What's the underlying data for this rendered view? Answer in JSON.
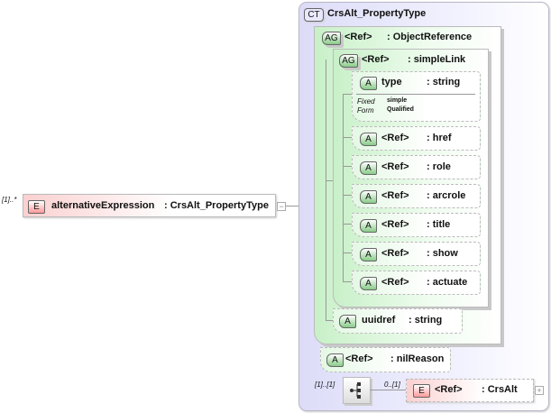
{
  "element": {
    "cardinality": "[1]..*",
    "badge": "E",
    "name": "alternativeExpression",
    "type": ": CrsAlt_PropertyType",
    "toggle": "−"
  },
  "complex_type": {
    "badge": "CT",
    "name": "CrsAlt_PropertyType"
  },
  "object_reference": {
    "badge": "AG",
    "name": "<Ref>",
    "type": ": ObjectReference"
  },
  "simple_link": {
    "badge": "AG",
    "name": "<Ref>",
    "type": ": simpleLink"
  },
  "type_attr": {
    "badge": "A",
    "name": "type",
    "type": ": string",
    "fixed_label": "Fixed",
    "fixed_value": "simple",
    "form_label": "Form",
    "form_value": "Qualified"
  },
  "link_attrs": [
    {
      "badge": "A",
      "name": "<Ref>",
      "type": ": href"
    },
    {
      "badge": "A",
      "name": "<Ref>",
      "type": ": role"
    },
    {
      "badge": "A",
      "name": "<Ref>",
      "type": ": arcrole"
    },
    {
      "badge": "A",
      "name": "<Ref>",
      "type": ": title"
    },
    {
      "badge": "A",
      "name": "<Ref>",
      "type": ": show"
    },
    {
      "badge": "A",
      "name": "<Ref>",
      "type": ": actuate"
    }
  ],
  "uuidref": {
    "badge": "A",
    "name": "uuidref",
    "type": ": string"
  },
  "nil_reason": {
    "badge": "A",
    "name": "<Ref>",
    "type": ": nilReason"
  },
  "sequence": {
    "cardinality": "[1]..[1]",
    "icon": "sequence-icon"
  },
  "crsalt": {
    "cardinality": "0..[1]",
    "badge": "E",
    "name": "<Ref>",
    "type": ": CrsAlt",
    "toggle": "+"
  }
}
